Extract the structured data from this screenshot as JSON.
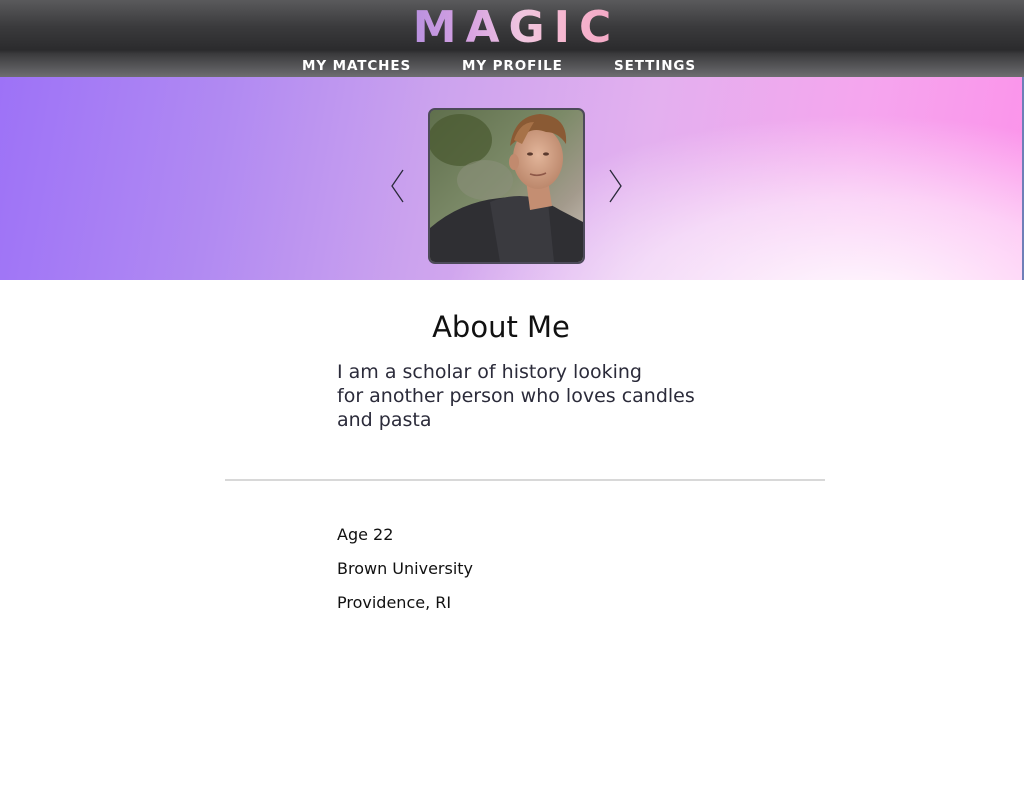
{
  "app": {
    "logo_text": "MAGIC",
    "logo_colors": [
      "#b48ee0",
      "#f0c6df",
      "#f3a7c4"
    ]
  },
  "nav": {
    "items": [
      {
        "label": "MY MATCHES"
      },
      {
        "label": "MY PROFILE"
      },
      {
        "label": "SETTINGS"
      }
    ]
  },
  "banner": {
    "gradient_colors": [
      "#9d72f7",
      "#cca3ee",
      "#fc92ea",
      "#ffffff"
    ],
    "prev_icon": "chevron-left-icon",
    "next_icon": "chevron-right-icon",
    "photo": "profile-photo"
  },
  "about": {
    "title": "About Me",
    "lines": [
      "I am a scholar of history looking",
      "for another person who loves candles",
      "and pasta"
    ]
  },
  "details": {
    "age": "Age 22",
    "school": "Brown University",
    "location": "Providence, RI"
  },
  "colors": {
    "header_dark": "#2b2b2d",
    "divider": "#d8d8d8"
  }
}
